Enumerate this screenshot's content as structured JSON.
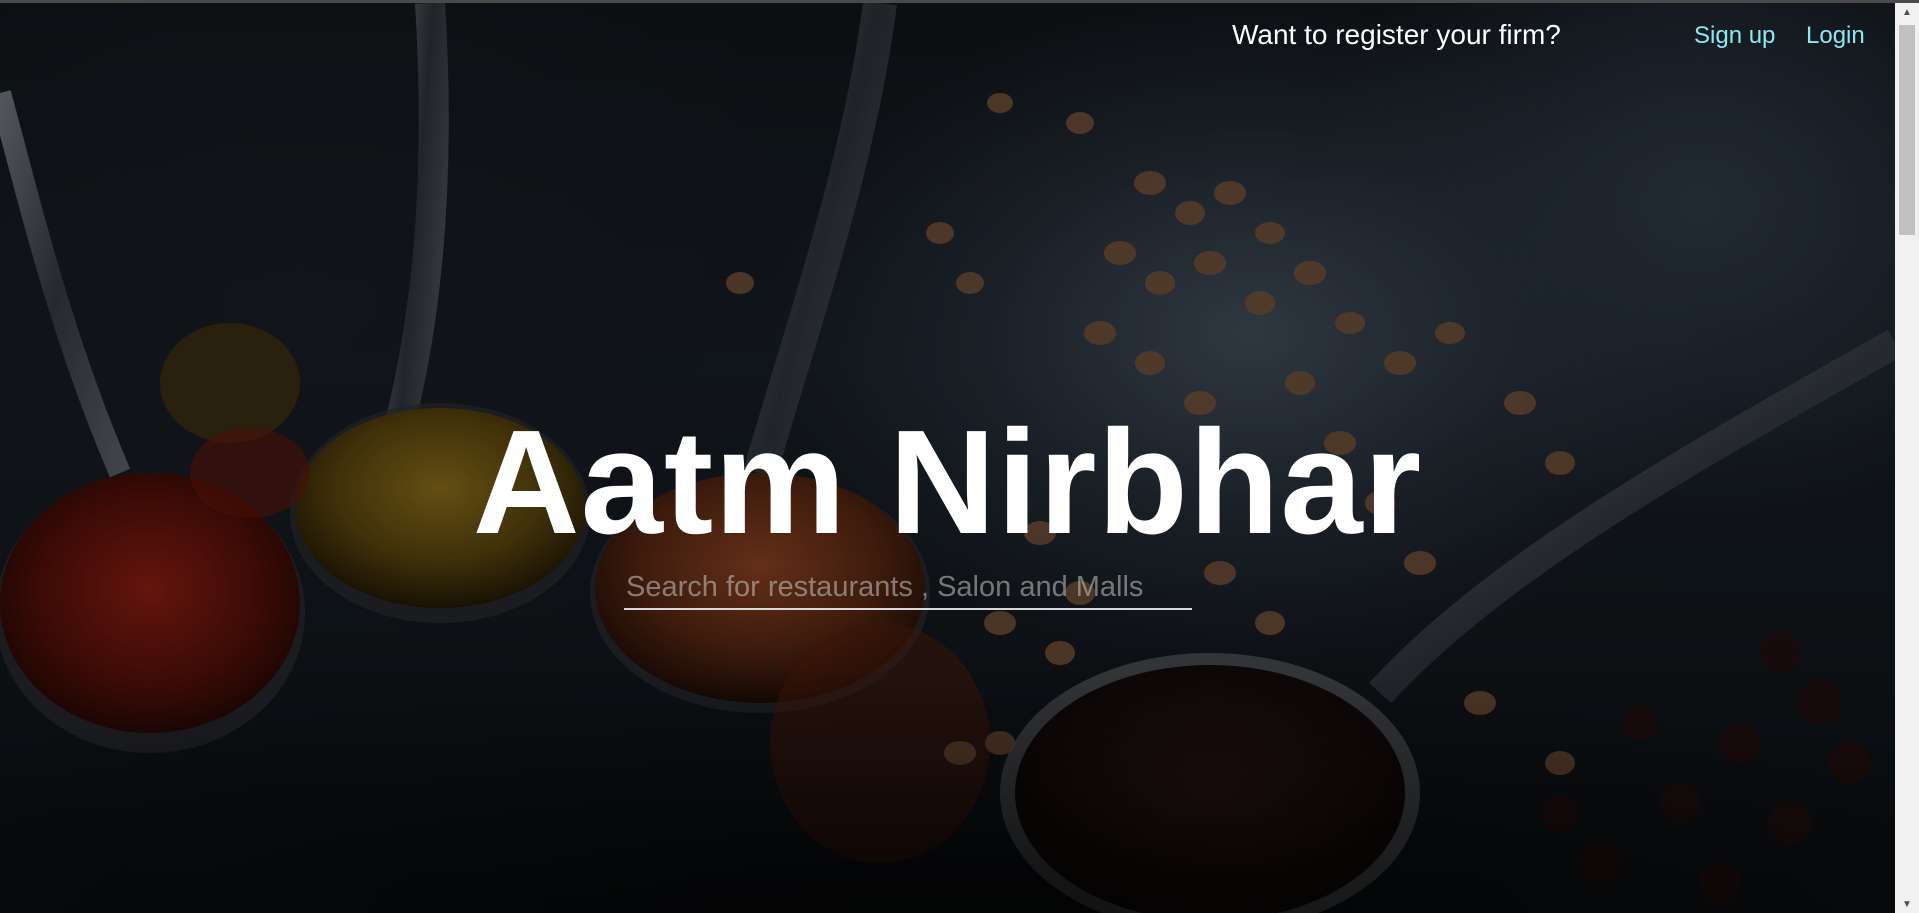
{
  "nav": {
    "register_text": "Want to register your firm?",
    "signup_label": "Sign up",
    "login_label": "Login"
  },
  "hero": {
    "title": "Aatm Nirbhar",
    "search_placeholder": "Search for restaurants , Salon and Malls",
    "search_value": ""
  },
  "colors": {
    "link": "#8fe8f0",
    "title": "#ffffff",
    "background": "#0b0d10"
  }
}
